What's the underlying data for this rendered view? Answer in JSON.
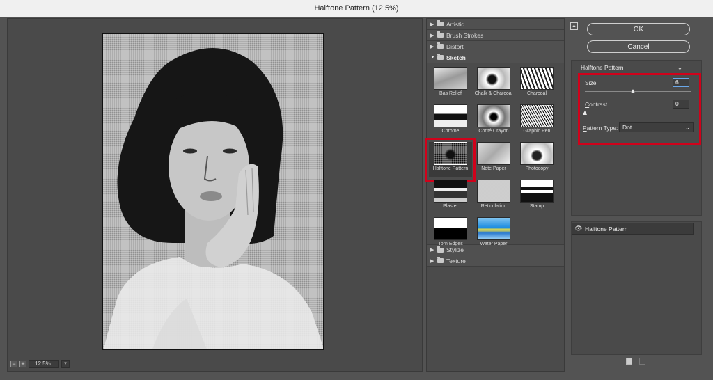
{
  "window": {
    "title": "Halftone Pattern (12.5%)"
  },
  "preview": {
    "zoom_out_label": "−",
    "zoom_in_label": "+",
    "zoom_value": "12.5%"
  },
  "gallery": {
    "categories_top": [
      {
        "label": "Artistic"
      },
      {
        "label": "Brush Strokes"
      },
      {
        "label": "Distort"
      }
    ],
    "open_category": {
      "label": "Sketch"
    },
    "filters": [
      {
        "label": "Bas Relief",
        "selected": false
      },
      {
        "label": "Chalk & Charcoal",
        "selected": false
      },
      {
        "label": "Charcoal",
        "selected": false
      },
      {
        "label": "Chrome",
        "selected": false
      },
      {
        "label": "Conté Crayon",
        "selected": false
      },
      {
        "label": "Graphic Pen",
        "selected": false
      },
      {
        "label": "Halftone Pattern",
        "selected": true
      },
      {
        "label": "Note Paper",
        "selected": false
      },
      {
        "label": "Photocopy",
        "selected": false
      },
      {
        "label": "Plaster",
        "selected": false
      },
      {
        "label": "Reticulation",
        "selected": false
      },
      {
        "label": "Stamp",
        "selected": false
      },
      {
        "label": "Torn Edges",
        "selected": false
      },
      {
        "label": "Water Paper",
        "selected": false
      }
    ],
    "categories_bottom": [
      {
        "label": "Stylize"
      },
      {
        "label": "Texture"
      }
    ]
  },
  "settings": {
    "ok_label": "OK",
    "cancel_label": "Cancel",
    "filter_name": "Halftone Pattern",
    "size": {
      "label_prefix": "",
      "label_underlined": "S",
      "label_rest": "ize",
      "value": "6",
      "slider_fraction": 0.45
    },
    "contrast": {
      "label_underlined": "C",
      "label_rest": "ontrast",
      "value": "0",
      "slider_fraction": 0.0
    },
    "pattern_type": {
      "label_underlined": "P",
      "label_rest": "attern Type:",
      "value": "Dot"
    }
  },
  "layers": {
    "items": [
      {
        "label": "Halftone Pattern",
        "visible": true
      }
    ]
  },
  "colors": {
    "highlight": "#d0021b",
    "focus": "#6aa7e8"
  }
}
